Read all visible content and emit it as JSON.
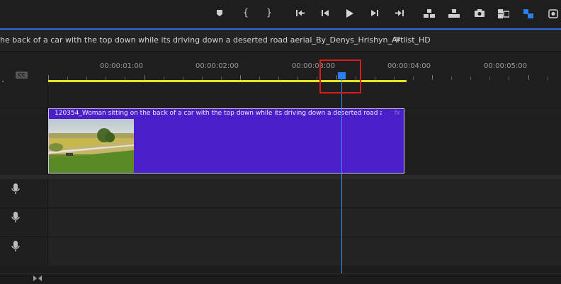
{
  "transport": {
    "buttons": [
      {
        "name": "marker-button",
        "icon": "marker-icon"
      },
      {
        "name": "mark-in-button",
        "icon": "mark-in-icon",
        "glyph": "{"
      },
      {
        "name": "mark-out-button",
        "icon": "mark-out-icon",
        "glyph": "}"
      },
      {
        "name": "go-to-in-button",
        "icon": "go-to-in-icon"
      },
      {
        "name": "step-back-button",
        "icon": "step-back-icon"
      },
      {
        "name": "play-button",
        "icon": "play-icon"
      },
      {
        "name": "step-forward-button",
        "icon": "step-forward-icon"
      },
      {
        "name": "go-to-out-button",
        "icon": "go-to-out-icon"
      },
      {
        "name": "lift-button",
        "icon": "lift-icon"
      },
      {
        "name": "extract-button",
        "icon": "extract-icon"
      },
      {
        "name": "export-frame-button",
        "icon": "camera-icon"
      },
      {
        "name": "comparison-view-button",
        "icon": "comparison-icon"
      },
      {
        "name": "proxy-toggle-button",
        "icon": "proxy-icon"
      },
      {
        "name": "multi-camera-button",
        "icon": "multicam-icon"
      }
    ]
  },
  "sequence": {
    "title": "he back of a car with the top down while its driving down a deserted road aerial_By_Denys_Hrishyn_Artlist_HD",
    "menu_glyph": "≡"
  },
  "ruler": {
    "timecodes": [
      "00:00:01:00",
      "00:00:02:00",
      "00:00:03:00",
      "00:00:04:00",
      "00:00:05:00"
    ],
    "cc_label": "CC"
  },
  "clip": {
    "label": "120354_Woman sitting on the back of a car with the top down while its driving down a deserted road aerial_By...",
    "fx": "fx",
    "color": "#4a1fc9"
  },
  "colors": {
    "accent": "#2b80f0",
    "work_area": "#e8e321",
    "highlight": "#e01818"
  }
}
